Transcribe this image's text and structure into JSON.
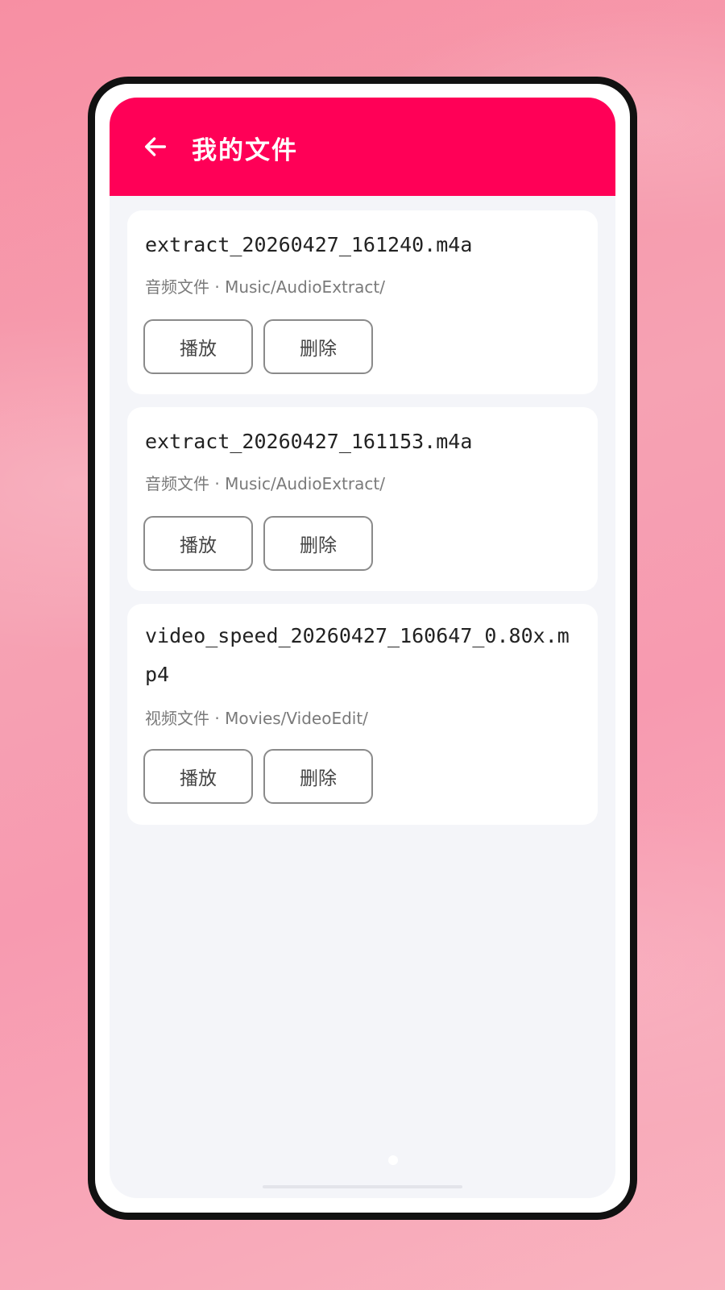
{
  "appbar": {
    "title": "我的文件",
    "back_icon": "arrow-left-icon"
  },
  "files": [
    {
      "name": "extract_20260427_161240.m4a",
      "meta": "音频文件 · Music/AudioExtract/",
      "play_label": "播放",
      "delete_label": "删除"
    },
    {
      "name": "extract_20260427_161153.m4a",
      "meta": "音频文件 · Music/AudioExtract/",
      "play_label": "播放",
      "delete_label": "删除"
    },
    {
      "name": "video_speed_20260427_160647_0.80x.mp4",
      "meta": "视频文件 · Movies/VideoEdit/",
      "play_label": "播放",
      "delete_label": "删除"
    }
  ],
  "colors": {
    "accent": "#ff0057",
    "background": "#f4f5f9",
    "card": "#ffffff"
  }
}
